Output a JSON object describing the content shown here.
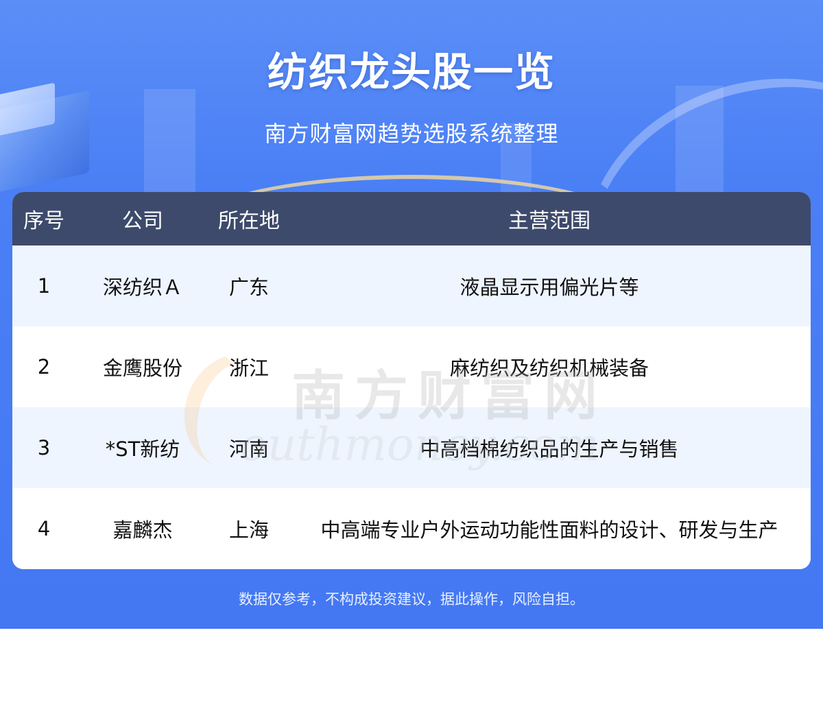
{
  "title": "纺织龙头股一览",
  "subtitle": "南方财富网趋势选股系统整理",
  "table": {
    "headers": [
      "序号",
      "公司",
      "所在地",
      "主营范围"
    ],
    "rows": [
      {
        "no": "1",
        "company": "深纺织Ａ",
        "location": "广东",
        "business": "液晶显示用偏光片等"
      },
      {
        "no": "2",
        "company": "金鹰股份",
        "location": "浙江",
        "business": "麻纺织及纺织机械装备"
      },
      {
        "no": "3",
        "company": "*ST新纺",
        "location": "河南",
        "business": "中高档棉纺织品的生产与销售"
      },
      {
        "no": "4",
        "company": "嘉麟杰",
        "location": "上海",
        "business": "中高端专业户外运动功能性面料的设计、研发与生产"
      }
    ]
  },
  "watermark": {
    "cn": "南方财富网",
    "en": "outhmoney.com"
  },
  "footer": "数据仅参考，不构成投资建议，据此操作，风险自担。",
  "colors": {
    "banner": "#4a7ff5",
    "header_row": "#3d4a6b",
    "odd_row": "#eef5ff"
  }
}
